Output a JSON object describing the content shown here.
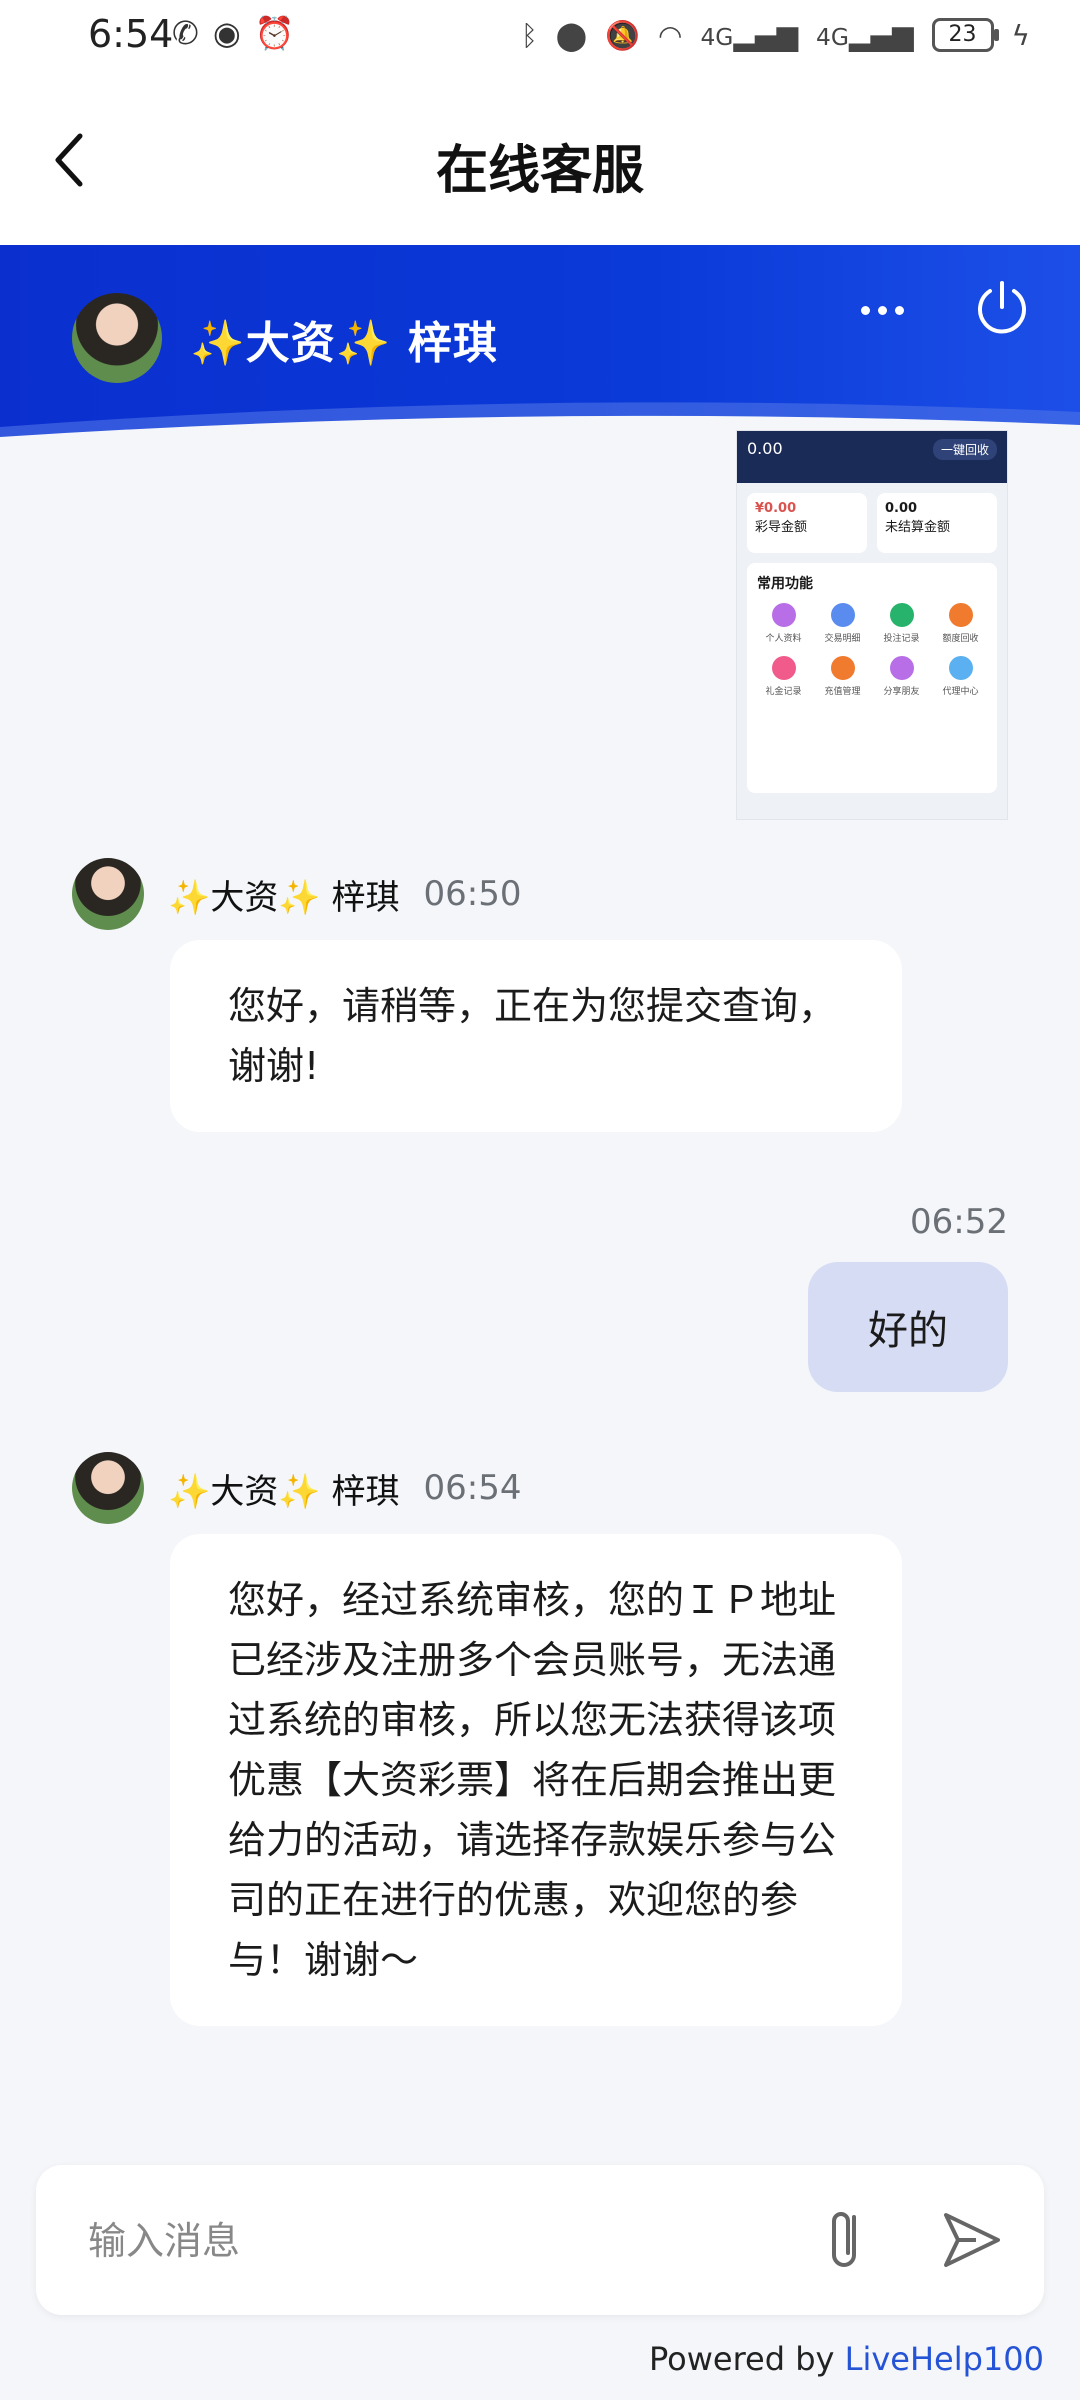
{
  "status_bar": {
    "time": "6:54",
    "net1": "4G",
    "net2": "4G",
    "battery": "23"
  },
  "header": {
    "title": "在线客服"
  },
  "agent": {
    "name": "✨大资✨ 梓琪"
  },
  "thumbnail": {
    "balance": "0.00",
    "recover_btn": "一键回收",
    "card1_amount": "¥0.00",
    "card1_label": "彩导金额",
    "card2_amount": "0.00",
    "card2_label": "未结算金额",
    "section_title": "常用功能",
    "items": [
      "个人资料",
      "交易明细",
      "投注记录",
      "额度回收",
      "礼金记录",
      "充值管理",
      "分享朋友",
      "代理中心"
    ]
  },
  "messages": [
    {
      "sender": "✨大资✨ 梓琪",
      "time": "06:50",
      "text": "您好，请稍等，正在为您提交查询，谢谢!"
    },
    {
      "sender": "me",
      "time": "06:52",
      "text": "好的"
    },
    {
      "sender": "✨大资✨ 梓琪",
      "time": "06:54",
      "text": "您好，经过系统审核，您的ＩＰ地址已经涉及注册多个会员账号，无法通过系统的审核，所以您无法获得该项优惠【大资彩票】将在后期会推出更给力的活动，请选择存款娱乐参与公司的正在进行的优惠，欢迎您的参与！谢谢～"
    }
  ],
  "composer": {
    "placeholder": "输入消息"
  },
  "footer": {
    "powered_prefix": "Powered by",
    "brand": "LiveHelp100"
  },
  "colors": {
    "banner": "#0b2fcf",
    "my_bubble": "#d6dcf3",
    "brand_link": "#2453d6"
  }
}
